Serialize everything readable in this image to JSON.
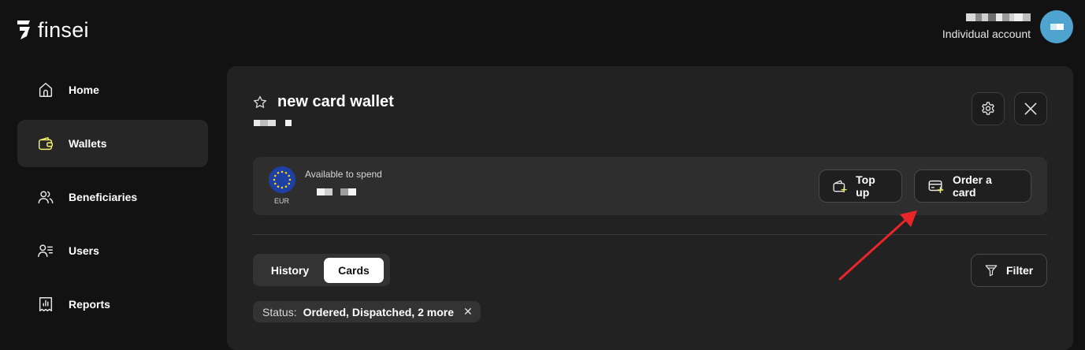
{
  "brand": {
    "name": "finsei"
  },
  "account": {
    "type": "Individual account"
  },
  "sidebar": {
    "items": [
      {
        "label": "Home",
        "icon": "home-icon",
        "active": false
      },
      {
        "label": "Wallets",
        "icon": "wallet-icon",
        "active": true
      },
      {
        "label": "Beneficiaries",
        "icon": "users-icon",
        "active": false
      },
      {
        "label": "Users",
        "icon": "user-list-icon",
        "active": false
      },
      {
        "label": "Reports",
        "icon": "report-icon",
        "active": false
      }
    ]
  },
  "wallet": {
    "title": "new card wallet",
    "currency": "EUR",
    "available_label": "Available to spend",
    "top_up_label": "Top up",
    "order_card_label": "Order a card"
  },
  "tabs": {
    "history": "History",
    "cards": "Cards",
    "active": "Cards"
  },
  "filter": {
    "label": "Filter"
  },
  "status_chip": {
    "label": "Status:",
    "value": "Ordered, Dispatched, 2 more"
  },
  "colors": {
    "background": "#121212",
    "panel": "#222222",
    "accent_yellow": "#f4f26a",
    "arrow_red": "#e8262a",
    "eu_blue": "#1e3fa3"
  }
}
